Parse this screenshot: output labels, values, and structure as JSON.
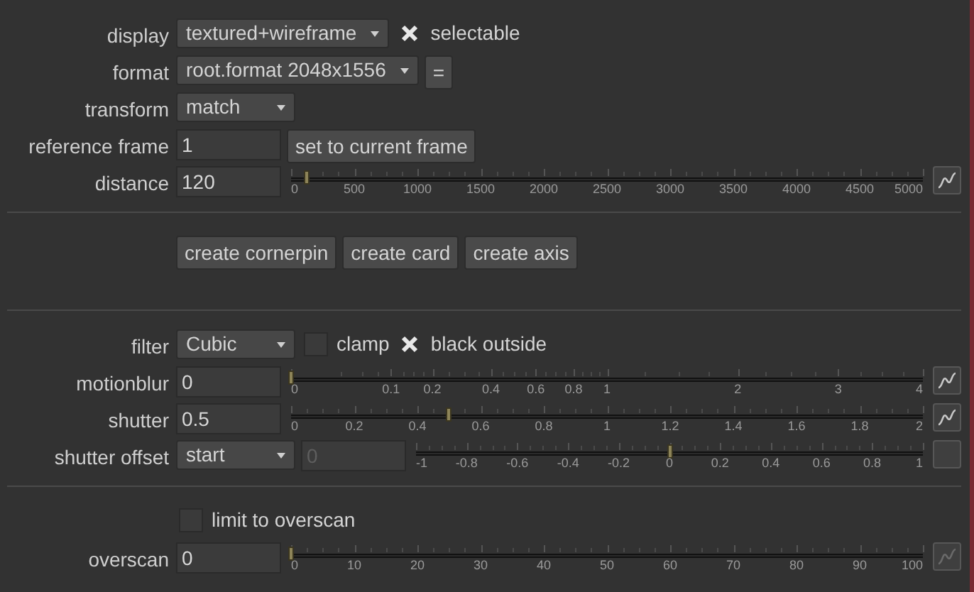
{
  "sections": [
    {
      "rows": [
        {
          "label": "display",
          "controls": [
            {
              "kind": "dropdown",
              "value": "textured+wireframe"
            },
            {
              "kind": "checkbox",
              "label": "selectable",
              "checked": true
            }
          ]
        },
        {
          "label": "format",
          "controls": [
            {
              "kind": "dropdown",
              "value": "root.format 2048x1556"
            },
            {
              "kind": "button",
              "label": "="
            }
          ]
        },
        {
          "label": "transform",
          "controls": [
            {
              "kind": "dropdown",
              "value": "match"
            }
          ]
        },
        {
          "label": "reference frame",
          "controls": [
            {
              "kind": "input",
              "value": "1",
              "disabled": false
            },
            {
              "kind": "button",
              "label": "set to current frame"
            }
          ]
        },
        {
          "label": "distance",
          "controls": [
            {
              "kind": "input",
              "value": "120",
              "disabled": false
            },
            {
              "kind": "slider",
              "level": 0.024,
              "ticks": [
                "0",
                "500",
                "1000",
                "1500",
                "2000",
                "2500",
                "3000",
                "3500",
                "4000",
                "4500",
                "5000"
              ]
            },
            {
              "kind": "curve"
            }
          ]
        }
      ]
    },
    {
      "rows": [
        {
          "controls": [
            {
              "kind": "button",
              "label": "create cornerpin"
            },
            {
              "kind": "button",
              "label": "create card"
            },
            {
              "kind": "button",
              "label": "create axis"
            }
          ]
        }
      ]
    },
    {
      "rows": [
        {
          "label": "filter",
          "controls": [
            {
              "kind": "dropdown",
              "value": "Cubic"
            },
            {
              "kind": "checkbox",
              "label": "clamp",
              "checked": false
            },
            {
              "kind": "checkbox",
              "label": "black outside",
              "checked": true
            }
          ]
        },
        {
          "label": "motionblur",
          "controls": [
            {
              "kind": "input",
              "value": "0",
              "disabled": false
            },
            {
              "kind": "rootslider",
              "level": 0,
              "ticks": [
                "0",
                "0.1",
                "0.2",
                "0.4",
                "0.6",
                "0.8",
                "1",
                "2",
                "3",
                "4"
              ]
            },
            {
              "kind": "curve"
            }
          ]
        },
        {
          "label": "shutter",
          "controls": [
            {
              "kind": "input",
              "value": "0.5",
              "disabled": false
            },
            {
              "kind": "slider",
              "level": 0.25,
              "ticks": [
                "0",
                "0.2",
                "0.4",
                "0.6",
                "0.8",
                "1",
                "1.2",
                "1.4",
                "1.6",
                "1.8",
                "2"
              ]
            },
            {
              "kind": "curve"
            }
          ]
        },
        {
          "label": "shutter offset",
          "controls": [
            {
              "kind": "dropdown",
              "value": "start"
            },
            {
              "kind": "input",
              "value": "0",
              "disabled": true
            },
            {
              "kind": "slider",
              "level": 0.5,
              "ticks": [
                "-1",
                "-0.8",
                "-0.6",
                "-0.4",
                "-0.2",
                "0",
                "0.2",
                "0.4",
                "0.6",
                "0.8",
                "1"
              ]
            },
            {
              "kind": "blank"
            }
          ]
        }
      ]
    },
    {
      "rows": [
        {
          "controls": [
            {
              "kind": "checkbox",
              "label": "limit to overscan",
              "checked": false
            }
          ]
        },
        {
          "label": "overscan",
          "controls": [
            {
              "kind": "input",
              "value": "0",
              "disabled": false
            },
            {
              "kind": "slider",
              "level": 0,
              "ticks": [
                "0",
                "10",
                "20",
                "30",
                "40",
                "50",
                "60",
                "70",
                "80",
                "90",
                "100"
              ]
            },
            {
              "kind": "dimcurve"
            }
          ]
        }
      ]
    }
  ]
}
